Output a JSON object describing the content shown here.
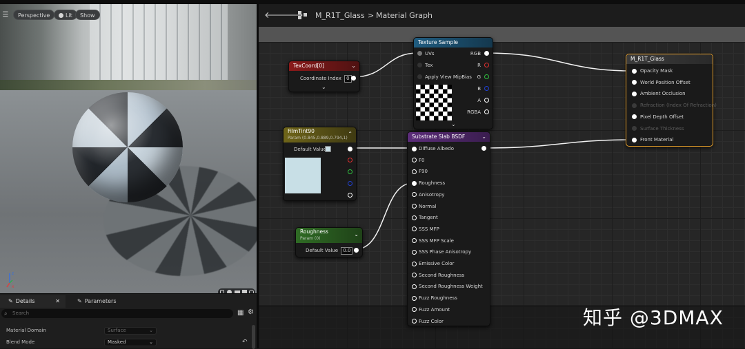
{
  "viewport": {
    "view_mode": "Perspective",
    "lighting_mode": "Lit",
    "show_label": "Show",
    "axis_x": "x",
    "axis_z": "z"
  },
  "details_panel": {
    "tab_details": "Details",
    "tab_parameters": "Parameters",
    "search_placeholder": "Search",
    "rows": [
      {
        "label": "Material Domain",
        "value": "Surface"
      },
      {
        "label": "Blend Mode",
        "value": "Masked"
      }
    ]
  },
  "graph_header": {
    "material_name": "M_R1T_Glass",
    "separator": ">",
    "graph_name": "Material Graph"
  },
  "nodes": {
    "texcoord": {
      "title": "TexCoord[0]",
      "pin_label": "Coordinate Index",
      "pin_value": "0",
      "header_color": "#8a1a1a"
    },
    "texture_sample": {
      "title": "Texture Sample",
      "inputs": [
        "UVs",
        "Tex",
        "Apply View MipBias"
      ],
      "outputs": [
        "RGB",
        "R",
        "G",
        "B",
        "A",
        "RGBA"
      ],
      "header_color": "#1f5c80"
    },
    "film_tint": {
      "title": "FilmTint90",
      "subtitle": "Param (0.845,0.889,0.794,1)",
      "pin_label": "Default Value",
      "swatch_color": "#c8dfe6",
      "header_color": "#6f6519"
    },
    "substrate": {
      "title": "Substrate Slab BSDF",
      "inputs": [
        "Diffuse Albedo",
        "F0",
        "F90",
        "Roughness",
        "Anisotropy",
        "Normal",
        "Tangent",
        "SSS MFP",
        "SSS MFP Scale",
        "SSS Phase Anisotropy",
        "Emissive Color",
        "Second Roughness",
        "Second Roughness Weight",
        "Fuzz Roughness",
        "Fuzz Amount",
        "Fuzz Color"
      ],
      "header_color": "#5c2d7a"
    },
    "roughness": {
      "title": "Roughness",
      "subtitle": "Param (0)",
      "pin_label": "Default Value",
      "pin_value": "0.0",
      "header_color": "#2f6b24"
    },
    "result": {
      "title": "M_R1T_Glass",
      "inputs": [
        {
          "label": "Opacity Mask",
          "enabled": true
        },
        {
          "label": "World Position Offset",
          "enabled": true
        },
        {
          "label": "Ambient Occlusion",
          "enabled": true
        },
        {
          "label": "Refraction (Index Of Refraction)",
          "enabled": false
        },
        {
          "label": "Pixel Depth Offset",
          "enabled": true
        },
        {
          "label": "Surface Thickness",
          "enabled": false
        },
        {
          "label": "Front Material",
          "enabled": true
        }
      ],
      "highlight_color": "#e8a02a"
    }
  },
  "watermark": "知乎 @3DMAX"
}
